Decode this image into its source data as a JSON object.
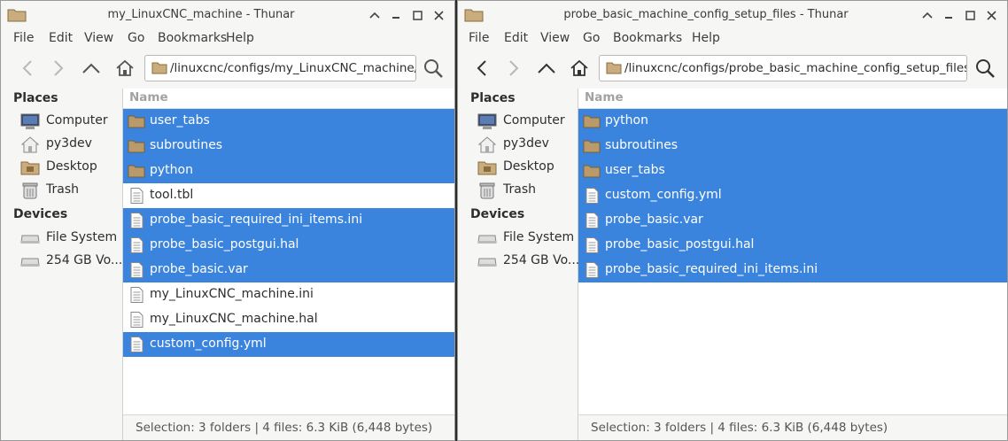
{
  "windows": [
    {
      "title": "my_LinuxCNC_machine - Thunar",
      "menu": [
        "File",
        "Edit",
        "View",
        "Go",
        "Bookmarks",
        "Help"
      ],
      "path": "/linuxcnc/configs/my_LinuxCNC_machine/",
      "sidebar": {
        "places_heading": "Places",
        "places": [
          {
            "label": "Computer",
            "icon": "computer-icon"
          },
          {
            "label": "py3dev",
            "icon": "home-icon"
          },
          {
            "label": "Desktop",
            "icon": "desktop-folder-icon"
          },
          {
            "label": "Trash",
            "icon": "trash-icon"
          }
        ],
        "devices_heading": "Devices",
        "devices": [
          {
            "label": "File System",
            "icon": "drive-icon"
          },
          {
            "label": "254 GB Vo...",
            "icon": "drive-icon"
          }
        ]
      },
      "column_name": "Name",
      "files": [
        {
          "name": "user_tabs",
          "type": "folder",
          "selected": true
        },
        {
          "name": "subroutines",
          "type": "folder",
          "selected": true
        },
        {
          "name": "python",
          "type": "folder",
          "selected": true
        },
        {
          "name": "tool.tbl",
          "type": "file",
          "selected": false
        },
        {
          "name": "probe_basic_required_ini_items.ini",
          "type": "file",
          "selected": true
        },
        {
          "name": "probe_basic_postgui.hal",
          "type": "file",
          "selected": true
        },
        {
          "name": "probe_basic.var",
          "type": "file",
          "selected": true
        },
        {
          "name": "my_LinuxCNC_machine.ini",
          "type": "file",
          "selected": false
        },
        {
          "name": "my_LinuxCNC_machine.hal",
          "type": "file",
          "selected": false
        },
        {
          "name": "custom_config.yml",
          "type": "file",
          "selected": true
        }
      ],
      "status": "Selection: 3 folders  |  4 files: 6.3 KiB (6,448 bytes)"
    },
    {
      "title": "probe_basic_machine_config_setup_files - Thunar",
      "menu": [
        "File",
        "Edit",
        "View",
        "Go",
        "Bookmarks",
        "Help"
      ],
      "path": "/linuxcnc/configs/probe_basic_machine_config_setup_files/",
      "sidebar": {
        "places_heading": "Places",
        "places": [
          {
            "label": "Computer",
            "icon": "computer-icon"
          },
          {
            "label": "py3dev",
            "icon": "home-icon"
          },
          {
            "label": "Desktop",
            "icon": "desktop-folder-icon"
          },
          {
            "label": "Trash",
            "icon": "trash-icon"
          }
        ],
        "devices_heading": "Devices",
        "devices": [
          {
            "label": "File System",
            "icon": "drive-icon"
          },
          {
            "label": "254 GB Vo...",
            "icon": "drive-icon"
          }
        ]
      },
      "column_name": "Name",
      "files": [
        {
          "name": "python",
          "type": "folder",
          "selected": true
        },
        {
          "name": "subroutines",
          "type": "folder",
          "selected": true
        },
        {
          "name": "user_tabs",
          "type": "folder",
          "selected": true
        },
        {
          "name": "custom_config.yml",
          "type": "file",
          "selected": true
        },
        {
          "name": "probe_basic.var",
          "type": "file",
          "selected": true
        },
        {
          "name": "probe_basic_postgui.hal",
          "type": "file",
          "selected": true
        },
        {
          "name": "probe_basic_required_ini_items.ini",
          "type": "file",
          "selected": true
        }
      ],
      "status": "Selection: 3 folders  |  4 files: 6.3 KiB (6,448 bytes)"
    }
  ],
  "colors": {
    "selection": "#3b84de",
    "folder": "#b99a6a",
    "window_bg": "#f6f6f5",
    "desktop": "#2b2b2b"
  }
}
